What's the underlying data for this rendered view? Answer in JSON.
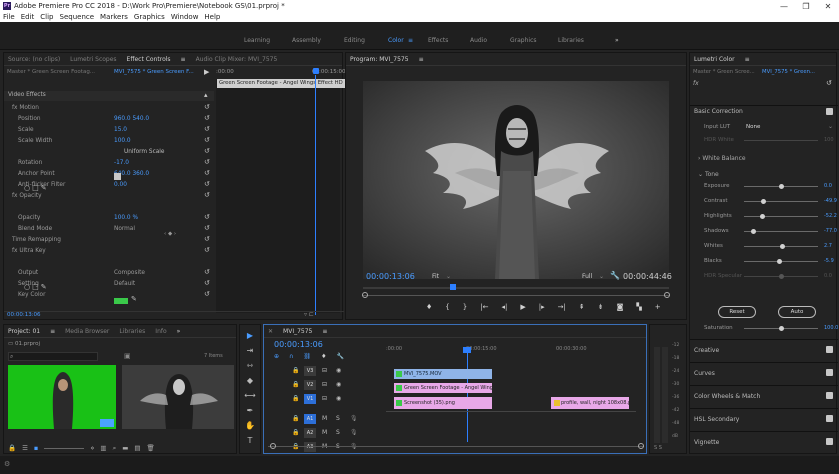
{
  "window": {
    "title": "Adobe Premiere Pro CC 2018 - D:\\Work Pro\\Premiere\\Notebook GS\\01.prproj *",
    "controls": [
      "—",
      "❐",
      "✕"
    ]
  },
  "menu": [
    "File",
    "Edit",
    "Clip",
    "Sequence",
    "Markers",
    "Graphics",
    "Window",
    "Help"
  ],
  "workspaces": [
    "Learning",
    "Assembly",
    "Editing",
    "Color",
    "Effects",
    "Audio",
    "Graphics",
    "Libraries"
  ],
  "workspace_active": "Color",
  "workspace_more": "»",
  "left_panel": {
    "tabs": [
      "Source: (no clips)",
      "Lumetri Scopes",
      "Effect Controls",
      "Audio Clip Mixer: MVI_7575"
    ],
    "master": "Master * Green Screen Footag...",
    "clip": "MVI_7575 * Green Screen F...",
    "timecode_start": ":00:00",
    "timecode_end": "00:00:15:00",
    "clip_label": "Green Screen Footage - Angel Wings Effect HD",
    "section": "Video Effects",
    "rows": [
      {
        "label": "fx  Motion",
        "value": "",
        "indent": 8
      },
      {
        "label": "Position",
        "value": "960.0    540.0",
        "indent": 14
      },
      {
        "label": "Scale",
        "value": "15.0",
        "indent": 14
      },
      {
        "label": "Scale Width",
        "value": "100.0",
        "indent": 14
      },
      {
        "label": "",
        "value": "Uniform Scale",
        "indent": 14
      },
      {
        "label": "Rotation",
        "value": "-17.0",
        "indent": 14
      },
      {
        "label": "Anchor Point",
        "value": "640.0    360.0",
        "indent": 14
      },
      {
        "label": "Anti-flicker Filter",
        "value": "0.00",
        "indent": 14
      },
      {
        "label": "fx  Opacity",
        "value": "",
        "indent": 8
      },
      {
        "label": "",
        "value": "",
        "indent": 14
      },
      {
        "label": "Opacity",
        "value": "100.0 %",
        "indent": 14
      },
      {
        "label": "Blend Mode",
        "value": "Normal",
        "indent": 14
      },
      {
        "label": "Time Remapping",
        "value": "",
        "indent": 8
      },
      {
        "label": "fx  Ultra Key",
        "value": "",
        "indent": 8
      },
      {
        "label": "",
        "value": "",
        "indent": 14
      },
      {
        "label": "Output",
        "value": "Composite",
        "indent": 14
      },
      {
        "label": "Setting",
        "value": "Default",
        "indent": 14
      },
      {
        "label": "Key Color",
        "value": "",
        "indent": 14
      }
    ],
    "bottom_timecode": "00:00:13:06"
  },
  "program": {
    "tab": "Program: MVI_7575",
    "timecode": "00:00:13:06",
    "fit": "Fit",
    "quality": "Full",
    "duration": "00:00:44:46"
  },
  "project": {
    "tabs": [
      "Project: 01",
      "Media Browser",
      "Libraries",
      "Info"
    ],
    "file": "01.prproj",
    "items_count": "7 Items"
  },
  "timeline": {
    "tab": "MVI_7575",
    "timecode": "00:00:13:06",
    "ruler": [
      ":00:00",
      "00:00:15:00",
      "00:00:30:00"
    ],
    "tracks": [
      "V3",
      "V2",
      "V1",
      "A1",
      "A2",
      "A3"
    ],
    "clips": [
      {
        "name": "MVI_7575.MOV",
        "track": "V3",
        "color": "#8fb4e8"
      },
      {
        "name": "Green Screen Footage - Angel Wings E",
        "track": "V2",
        "color": "#e8a8e8"
      },
      {
        "name": "Screenshot (35).png",
        "track": "V1",
        "color": "#e8a8e8"
      },
      {
        "name": "profile, wall, night 108x08.p",
        "track": "V1b",
        "color": "#e8a8e8"
      }
    ],
    "meter_labels": [
      "-12",
      "-18",
      "-24",
      "-30",
      "-36",
      "-42",
      "-48",
      "dB"
    ]
  },
  "lumetri": {
    "tab": "Lumetri Color",
    "master": "Master * Green Scree...",
    "clip": "MVI_7575 * Green...",
    "basic": "Basic Correction",
    "input_lut_label": "Input LUT",
    "input_lut_value": "None",
    "hdr_white": "HDR White",
    "hdr_val": "100",
    "white_balance": "White Balance",
    "tone": "Tone",
    "sliders": [
      {
        "label": "Exposure",
        "value": "0.0",
        "pos": 0.5
      },
      {
        "label": "Contrast",
        "value": "-49.9",
        "pos": 0.25
      },
      {
        "label": "Highlights",
        "value": "-52.2",
        "pos": 0.24
      },
      {
        "label": "Shadows",
        "value": "-77.0",
        "pos": 0.12
      },
      {
        "label": "Whites",
        "value": "2.7",
        "pos": 0.51
      },
      {
        "label": "Blacks",
        "value": "-5.9",
        "pos": 0.47
      },
      {
        "label": "HDR Specular",
        "value": "0.0",
        "pos": 0.5
      }
    ],
    "reset": "Reset",
    "auto": "Auto",
    "saturation_label": "Saturation",
    "saturation_value": "100.0",
    "sections": [
      "Creative",
      "Curves",
      "Color Wheels & Match",
      "HSL Secondary",
      "Vignette"
    ]
  }
}
